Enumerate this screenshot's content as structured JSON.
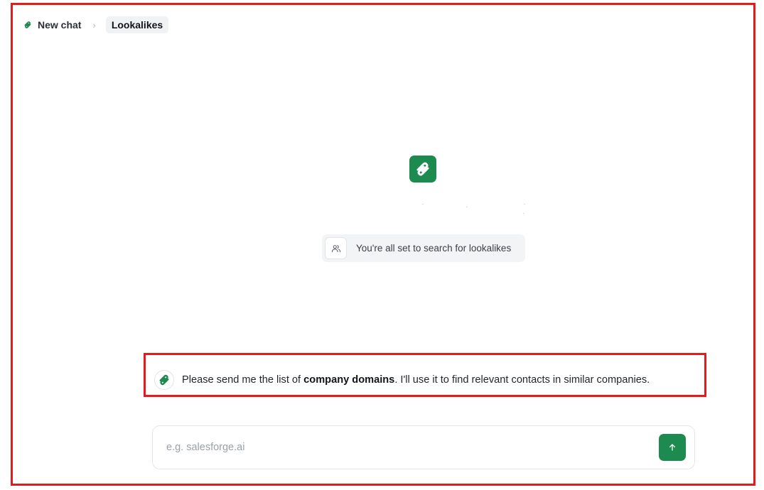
{
  "breadcrumb": {
    "new_chat": "New chat",
    "current": "Lookalikes"
  },
  "status": {
    "text": "You're all set to search for lookalikes",
    "icon": "users-icon"
  },
  "message": {
    "prefix": "Please send me the list of ",
    "bold": "company domains",
    "suffix": ". I'll use it to find relevant contacts in similar companies."
  },
  "composer": {
    "placeholder": "e.g. salesforge.ai",
    "value": ""
  },
  "colors": {
    "brand": "#1d8a4f",
    "highlight": "#e31b1b"
  },
  "icons": {
    "brand": "salesforge-logo-icon",
    "separator": "chevron-right-icon",
    "send": "arrow-up-icon"
  }
}
